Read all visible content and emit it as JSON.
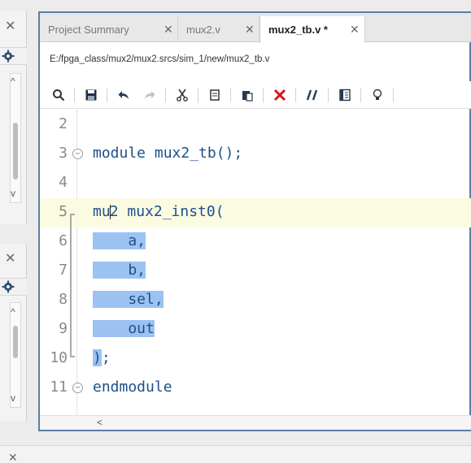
{
  "tabs": [
    {
      "label": "Project Summary",
      "active": false
    },
    {
      "label": "mux2.v",
      "active": false
    },
    {
      "label": "mux2_tb.v *",
      "active": true
    }
  ],
  "file_path": "E:/fpga_class/mux2/mux2.srcs/sim_1/new/mux2_tb.v",
  "toolbar": [
    "search-icon",
    "save-icon",
    "undo-icon",
    "redo-icon",
    "cut-icon",
    "copy-icon",
    "paste-icon",
    "delete-icon",
    "comment-icon",
    "insert-template-icon",
    "lightbulb-icon"
  ],
  "code_lines": [
    {
      "num": "2",
      "text": ""
    },
    {
      "num": "3",
      "text": "module mux2_tb();"
    },
    {
      "num": "4",
      "text": ""
    },
    {
      "num": "5",
      "text_before": "mu",
      "text_after": "2 mux2_inst0("
    },
    {
      "num": "6",
      "indent": "    ",
      "sel": "    a,"
    },
    {
      "num": "7",
      "indent": "    ",
      "sel": "    b,"
    },
    {
      "num": "8",
      "indent": "    ",
      "sel": "    sel,"
    },
    {
      "num": "9",
      "indent": "    ",
      "sel": "    out"
    },
    {
      "num": "10",
      "sel": ")",
      "rest": ";"
    },
    {
      "num": "11",
      "text": "endmodule"
    }
  ],
  "colors": {
    "keyword": "#1f4f8a",
    "selection": "#9cc2f2",
    "current_line": "#fbfbe2",
    "editor_border": "#5b7fa6"
  }
}
